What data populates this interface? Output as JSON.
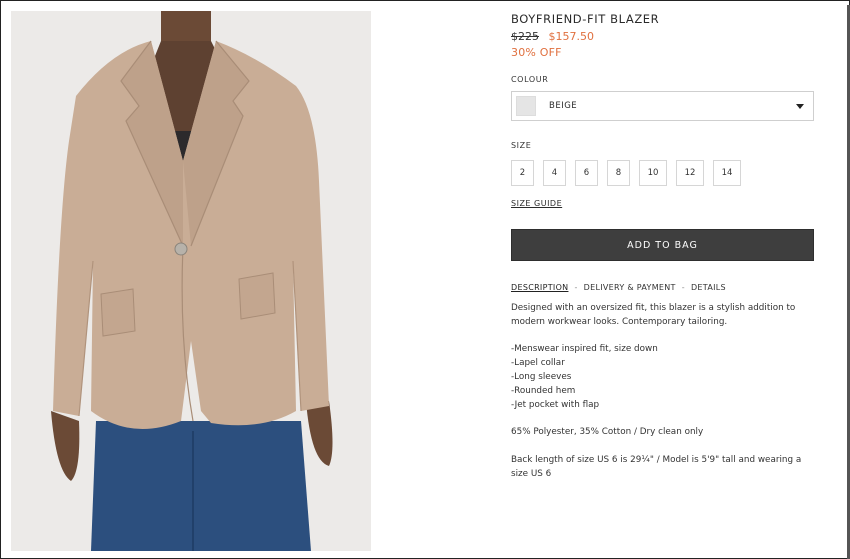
{
  "product": {
    "title": "BOYFRIEND-FIT BLAZER",
    "old_price": "$225",
    "new_price": "$157.50",
    "discount": "30% OFF",
    "image_alt": "Beige boyfriend-fit blazer worn with jeans"
  },
  "colour": {
    "label": "COLOUR",
    "selected": "BEIGE",
    "swatch_color": "#e5e5e5"
  },
  "size": {
    "label": "SIZE",
    "options": [
      "2",
      "4",
      "6",
      "8",
      "10",
      "12",
      "14"
    ],
    "guide": "SIZE GUIDE"
  },
  "cta": {
    "label": "ADD TO BAG"
  },
  "tabs": {
    "description": "DESCRIPTION",
    "delivery": "DELIVERY & PAYMENT",
    "details": "DETAILS",
    "separator": "-"
  },
  "description": {
    "intro_1": "Designed with an oversized fit, this blazer is a stylish addition to",
    "intro_2": "modern workwear looks. Contemporary tailoring.",
    "bullets": [
      "-Menswear inspired fit,  size down",
      "-Lapel collar",
      "-Long sleeves",
      "-Rounded hem",
      "-Jet pocket with flap"
    ],
    "composition": "65% Polyester, 35% Cotton / Dry clean only",
    "fit_1": "Back length of size US 6 is 29¼\" / Model is 5'9\" tall and wearing a",
    "fit_2": "size US 6"
  },
  "colors": {
    "accent": "#e0703f",
    "cta_bg": "#3e3e3e",
    "blazer": "#c9ad96"
  }
}
